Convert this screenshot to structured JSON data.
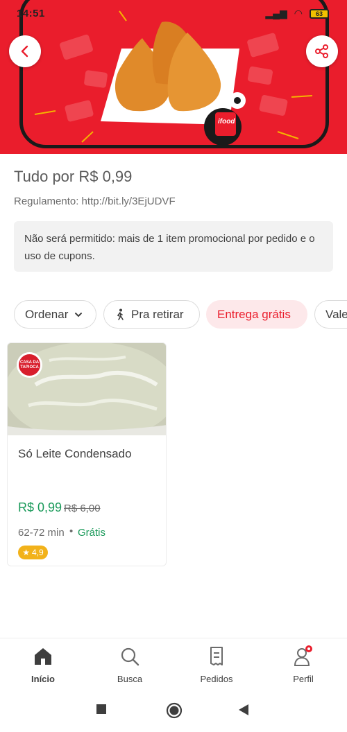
{
  "status_bar": {
    "time": "14:51",
    "battery": "63"
  },
  "banner": {
    "badge_text": "ifood"
  },
  "promo": {
    "title": "Tudo por R$ 0,99",
    "rules": "Regulamento: http://bit.ly/3EjUDVF",
    "notice": "Não será permitido: mais de 1 item promocional por pedido e o uso de cupons."
  },
  "filters": [
    {
      "label": "Ordenar",
      "icon": "chevron-down-icon"
    },
    {
      "label": "Pra retirar",
      "icon": "walking-icon"
    },
    {
      "label": "Entrega grátis",
      "active": true
    },
    {
      "label": "Vale"
    }
  ],
  "products": [
    {
      "name": "Só Leite Condensado",
      "store_logo_text": "CASA DA TAPIOCA",
      "price": "R$ 0,99",
      "old_price": "R$ 6,00",
      "eta": "62-72 min",
      "separator": "•",
      "delivery": "Grátis",
      "rating": "4,9"
    }
  ],
  "bottom_nav": [
    {
      "label": "Início",
      "icon": "home-icon",
      "active": true
    },
    {
      "label": "Busca",
      "icon": "search-icon"
    },
    {
      "label": "Pedidos",
      "icon": "receipt-icon"
    },
    {
      "label": "Perfil",
      "icon": "user-icon",
      "badge": true
    }
  ],
  "colors": {
    "brand_red": "#ea1d2c",
    "price_green": "#1a9a5a",
    "rating_yellow": "#f2b21a",
    "chip_active_bg": "#fde8ea"
  }
}
